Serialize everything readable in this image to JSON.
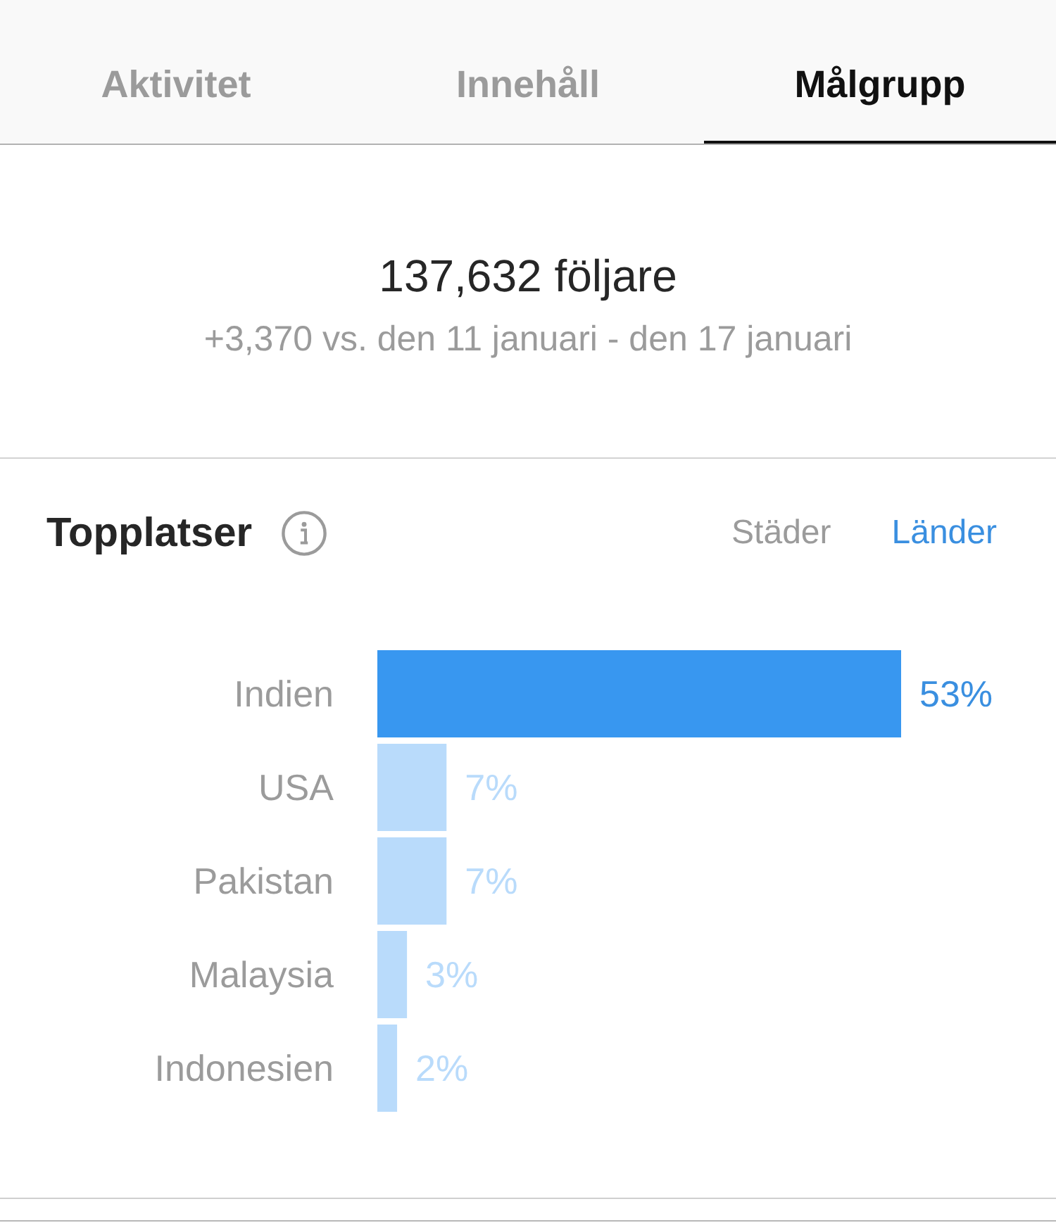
{
  "tabs": [
    {
      "label": "Aktivitet",
      "selected": false
    },
    {
      "label": "Innehåll",
      "selected": false
    },
    {
      "label": "Målgrupp",
      "selected": true
    }
  ],
  "followers": {
    "count": "137,632 följare",
    "change": "+3,370 vs. den 11 januari - den 17 januari"
  },
  "top_locations": {
    "title": "Topplatser",
    "filters": [
      {
        "label": "Städer",
        "selected": false
      },
      {
        "label": "Länder",
        "selected": true
      }
    ],
    "chart_data": {
      "type": "bar",
      "orientation": "horizontal",
      "categories": [
        "Indien",
        "USA",
        "Pakistan",
        "Malaysia",
        "Indonesien"
      ],
      "values": [
        53,
        7,
        7,
        3,
        2
      ],
      "value_labels": [
        "53%",
        "7%",
        "7%",
        "3%",
        "2%"
      ]
    }
  }
}
